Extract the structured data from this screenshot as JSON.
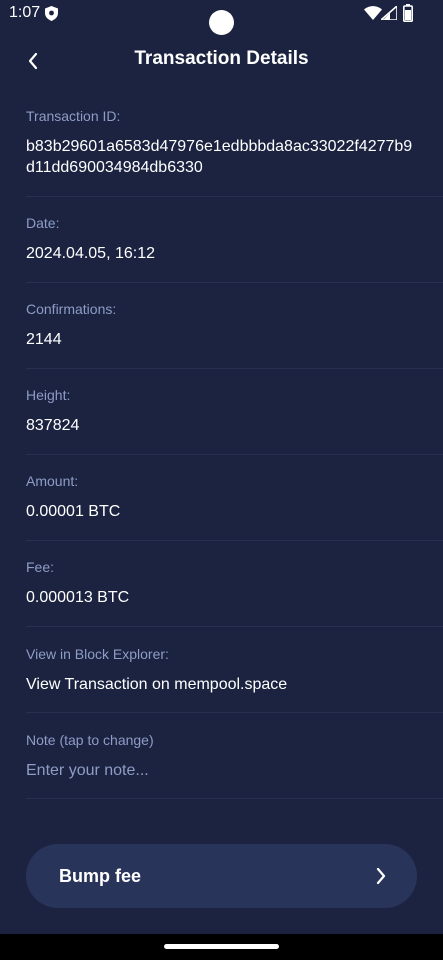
{
  "status_bar": {
    "time": "1:07",
    "icons": [
      "shield-icon",
      "wifi-icon",
      "signal-icon",
      "battery-icon"
    ]
  },
  "header": {
    "title": "Transaction Details",
    "back_icon": "chevron-left-icon"
  },
  "details": {
    "transaction_id": {
      "label": "Transaction ID:",
      "value": "b83b29601a6583d47976e1edbbbda8ac33022f4277b9d11dd690034984db6330"
    },
    "date": {
      "label": "Date:",
      "value": "2024.04.05, 16:12"
    },
    "confirmations": {
      "label": "Confirmations:",
      "value": "2144"
    },
    "height": {
      "label": "Height:",
      "value": "837824"
    },
    "amount": {
      "label": "Amount:",
      "value": "0.00001 BTC"
    },
    "fee": {
      "label": "Fee:",
      "value": "0.000013 BTC"
    },
    "explorer": {
      "label": "View in Block Explorer:",
      "value": "View Transaction on mempool.space"
    },
    "note": {
      "label": "Note (tap to change)",
      "placeholder": "Enter your note..."
    }
  },
  "actions": {
    "bump_fee_label": "Bump fee"
  },
  "colors": {
    "background": "#1b2340",
    "label": "#8e9cc6",
    "divider": "#27304f",
    "button": "#29345a"
  }
}
